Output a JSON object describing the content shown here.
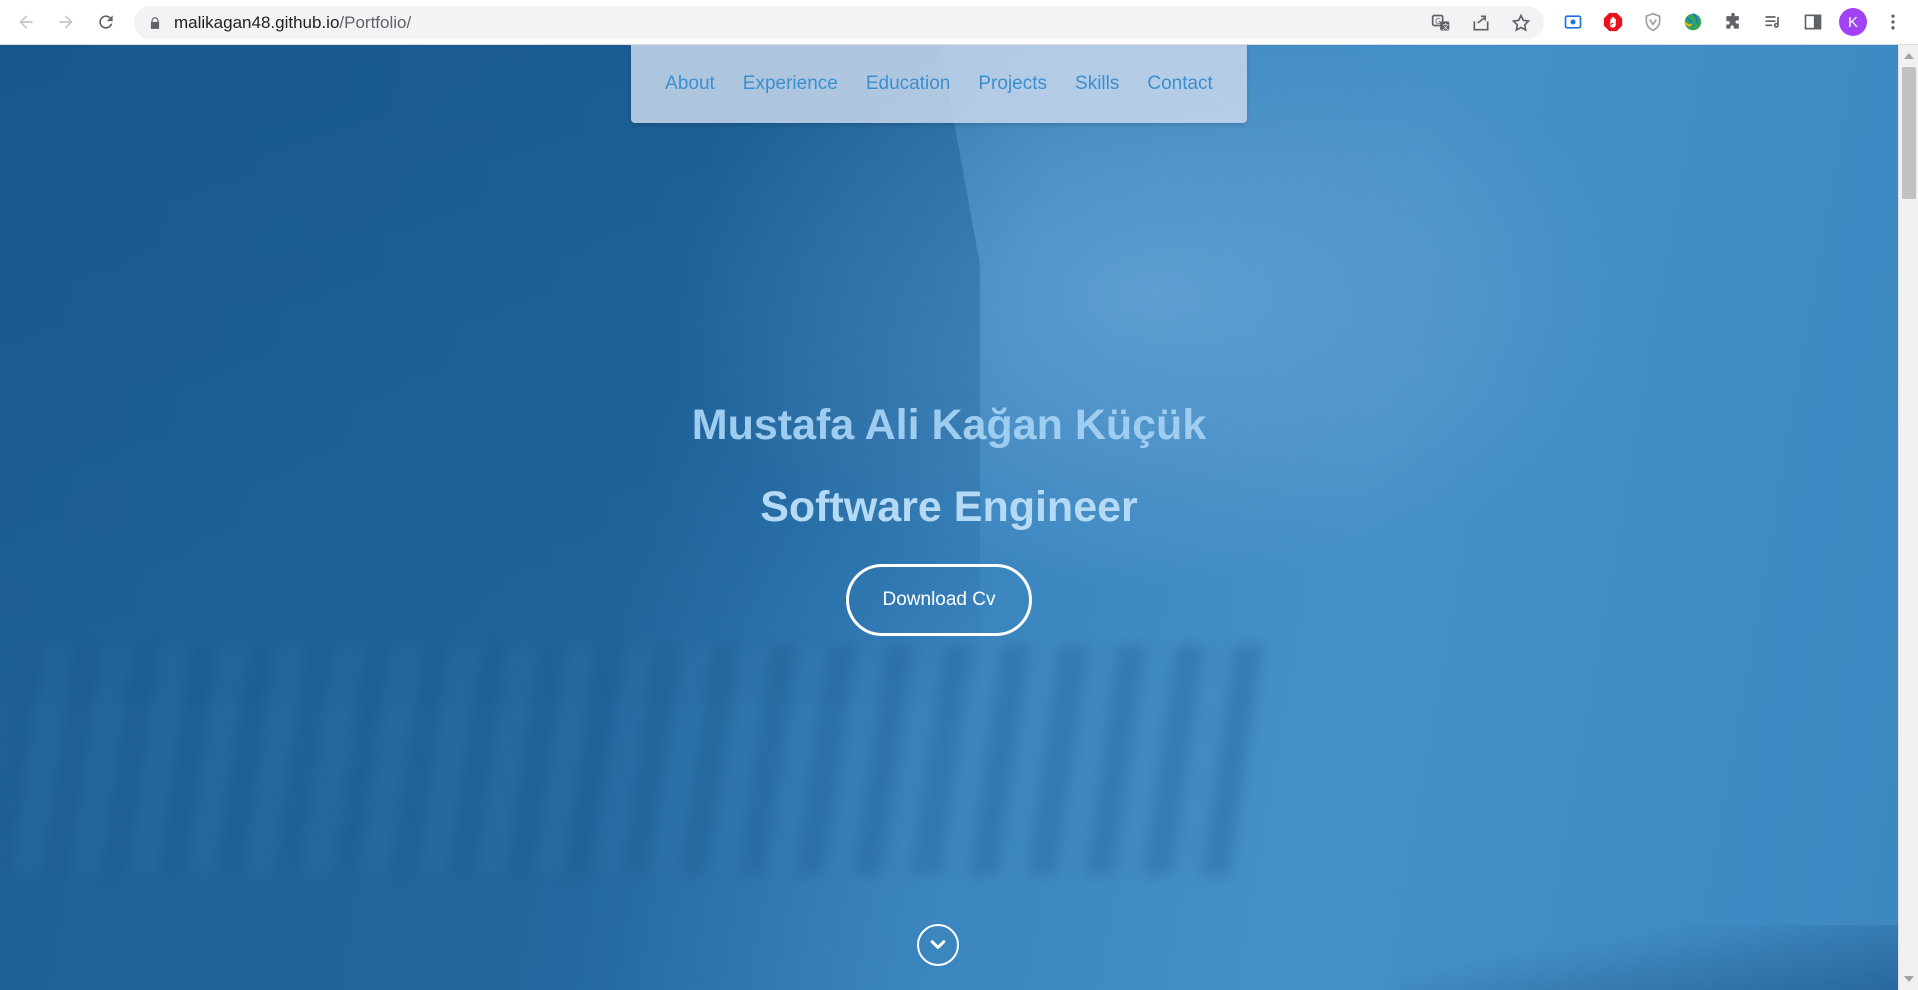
{
  "browser": {
    "url_host": "malikagan48.github.io",
    "url_path": "/Portfolio/",
    "profile_initial": "K",
    "icons": [
      "back-icon",
      "forward-icon",
      "reload-icon",
      "lock-icon",
      "translate-icon",
      "share-icon",
      "bookmark-star-icon",
      "screen-capture-extension-icon",
      "adblock-extension-icon",
      "shield-extension-icon",
      "globe-extension-icon",
      "extensions-puzzle-icon",
      "media-control-icon",
      "side-panel-icon",
      "menu-kebab-icon"
    ]
  },
  "nav": {
    "items": [
      {
        "label": "About"
      },
      {
        "label": "Experience"
      },
      {
        "label": "Education"
      },
      {
        "label": "Projects"
      },
      {
        "label": "Skills"
      },
      {
        "label": "Contact"
      }
    ]
  },
  "hero": {
    "name": "Mustafa Ali Kağan Küçük",
    "role": "Software Engineer",
    "cv_button": "Download Cv"
  },
  "colors": {
    "nav_link": "#3b8fd0",
    "hero_bg": "#2a6fa8",
    "avatar": "#a142f4"
  }
}
